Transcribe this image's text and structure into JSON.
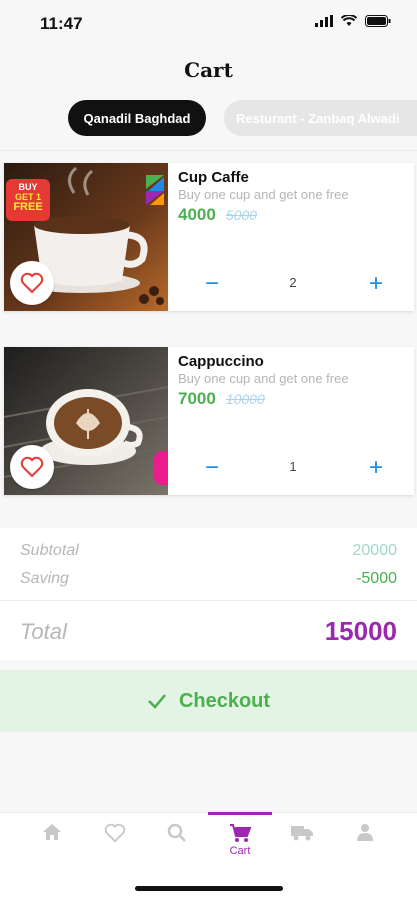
{
  "status_bar": {
    "time": "11:47"
  },
  "page": {
    "title": "Cart"
  },
  "tabs": [
    {
      "label": "Qanadil Baghdad",
      "active": true
    },
    {
      "label": "Resturant - Zanbaq Alwadi",
      "active": false
    }
  ],
  "items": [
    {
      "name": "Cup Caffe",
      "description": "Buy one cup and get one free",
      "price": "4000",
      "old_price": "5000",
      "quantity": "2",
      "badge_text": [
        "BUY",
        "GET 1",
        "FREE"
      ]
    },
    {
      "name": "Cappuccino",
      "description": "Buy one cup and get one free",
      "price": "7000",
      "old_price": "10000",
      "quantity": "1"
    }
  ],
  "summary": {
    "subtotal_label": "Subtotal",
    "subtotal_value": "20000",
    "saving_label": "Saving",
    "saving_value": "-5000",
    "total_label": "Total",
    "total_value": "15000"
  },
  "checkout": {
    "label": "Checkout"
  },
  "bottom_nav": {
    "items": [
      {
        "icon": "home-icon"
      },
      {
        "icon": "heart-icon"
      },
      {
        "icon": "search-icon"
      },
      {
        "icon": "cart-icon",
        "label": "Cart",
        "active": true
      },
      {
        "icon": "truck-icon"
      },
      {
        "icon": "person-icon"
      }
    ]
  },
  "colors": {
    "accent": "#9c27b0",
    "price_green": "#4caf50",
    "qty_blue": "#1e88e5",
    "checkout_bg": "#e3f4e5"
  }
}
